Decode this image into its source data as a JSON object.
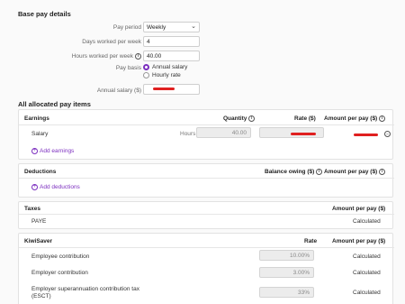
{
  "base": {
    "title": "Base pay details",
    "pay_period_label": "Pay period",
    "pay_period_value": "Weekly",
    "days_label": "Days worked per week",
    "days_value": "4",
    "hours_label": "Hours worked per week",
    "hours_value": "40.00",
    "basis_label": "Pay basis",
    "basis_options": [
      "Annual salary",
      "Hourly rate"
    ],
    "basis_selected": "Annual salary",
    "annual_label": "Annual salary ($)"
  },
  "items": {
    "title": "All allocated pay items",
    "earnings": {
      "header": "Earnings",
      "quantity_header": "Quantity",
      "rate_header": "Rate ($)",
      "amount_header": "Amount per pay ($)",
      "row_name": "Salary",
      "row_unit": "Hours",
      "row_quantity": "40.00",
      "add_label": "Add earnings"
    },
    "deductions": {
      "header": "Deductions",
      "balance_header": "Balance owing ($)",
      "amount_header": "Amount per pay ($)",
      "add_label": "Add deductions"
    },
    "taxes": {
      "header": "Taxes",
      "amount_header": "Amount per pay ($)",
      "row_name": "PAYE",
      "row_value": "Calculated"
    },
    "kiwisaver": {
      "header": "KiwiSaver",
      "rate_header": "Rate",
      "amount_header": "Amount per pay ($)",
      "rows": [
        {
          "name": "Employee contribution",
          "rate": "10.00%",
          "amount": "Calculated"
        },
        {
          "name": "Employer contribution",
          "rate": "3.00%",
          "amount": "Calculated"
        },
        {
          "name": "Employer superannuation contribution tax",
          "name2": "(ESCT)",
          "rate": "33%",
          "amount": "Calculated"
        }
      ]
    }
  },
  "colors": {
    "accent": "#7c2fbf",
    "redaction": "#e02020"
  },
  "icons": [
    "info-icon",
    "chevron-down-icon",
    "plus-circle-icon",
    "more-icon"
  ]
}
